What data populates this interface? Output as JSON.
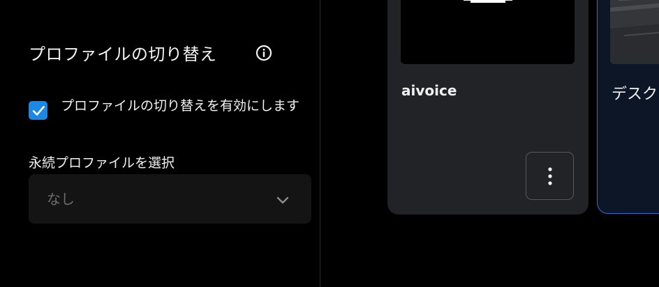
{
  "settings": {
    "section_title": "プロファイルの切り替え",
    "enable_checkbox": {
      "checked": true,
      "label": "プロファイルの切り替えを有効にします"
    },
    "persistent_profile": {
      "label": "永続プロファイルを選択",
      "selected_value": "なし"
    }
  },
  "profiles": [
    {
      "name": "aivoice",
      "thumbnail_icon": "white-circle-logo-icon",
      "menu_icon": "more-vertical-icon"
    },
    {
      "name": "デスク",
      "thumbnail_icon": "desk-photo-image",
      "selected": true
    }
  ],
  "colors": {
    "accent": "#1a88e6",
    "selected_border": "#2f6fd4",
    "card_bg": "#222326",
    "panel_bg": "#000000"
  }
}
